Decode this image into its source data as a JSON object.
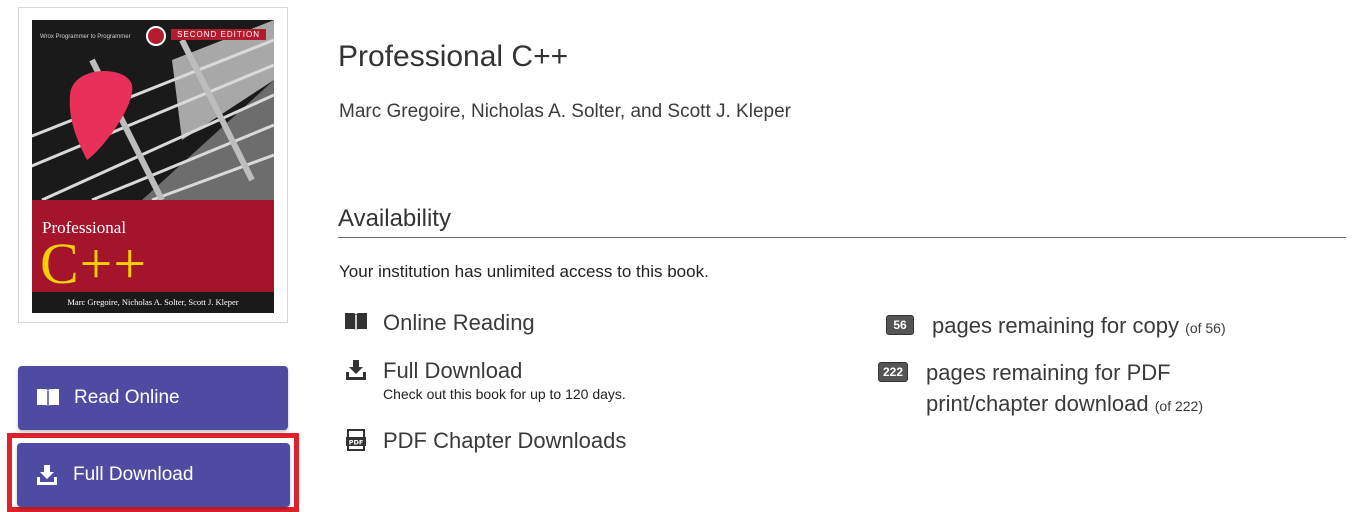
{
  "cover": {
    "topline": "Wrox Programmer to Programmer",
    "edition": "SECOND EDITION",
    "series": "Professional",
    "title": "C++",
    "authors": "Marc Gregoire, Nicholas A. Solter, Scott J. Kleper",
    "colors": {
      "band": "#a4152b",
      "title": "#f5d000",
      "pick": "#e8305a"
    }
  },
  "sidebar": {
    "read_online_label": "Read Online",
    "full_download_label": "Full Download",
    "button_color": "#4f4ba3",
    "highlight_color": "#e0202a"
  },
  "book": {
    "title": "Professional C++",
    "authors": "Marc Gregoire, Nicholas A. Solter, and Scott J. Kleper"
  },
  "availability": {
    "heading": "Availability",
    "note": "Your institution has unlimited access to this book.",
    "features": [
      {
        "icon": "book-open-icon",
        "label": "Online Reading"
      },
      {
        "icon": "download-icon",
        "label": "Full Download",
        "sub": "Check out this book for up to 120 days."
      },
      {
        "icon": "pdf-icon",
        "label": "PDF Chapter Downloads"
      }
    ],
    "quotas": [
      {
        "count": "56",
        "text": "pages remaining for copy",
        "of": "(of 56)"
      },
      {
        "count": "222",
        "text_line1": "pages remaining for PDF",
        "text_line2": "print/chapter download",
        "of": "(of 222)"
      }
    ]
  }
}
